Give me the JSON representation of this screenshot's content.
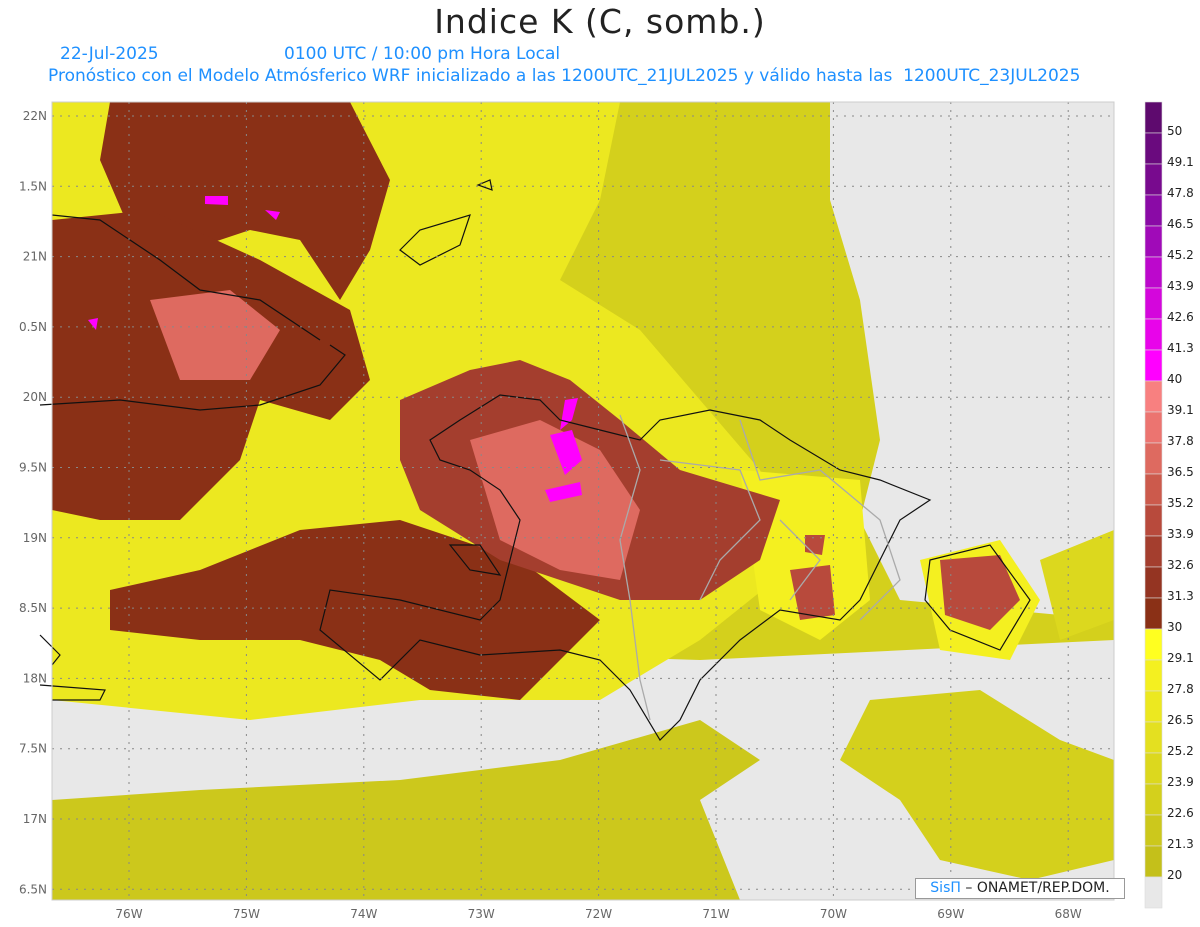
{
  "header": {
    "title": "Indice K (C, somb.)",
    "date": "22-Jul-2025",
    "time": "0100 UTC / 10:00 pm Hora Local",
    "description": "Pronóstico con el Modelo Atmósferico WRF inicializado a las 1200UTC_21JUL2025 y válido hasta las  1200UTC_23JUL2025"
  },
  "axes": {
    "lon_labels": [
      "76W",
      "75W",
      "74W",
      "73W",
      "72W",
      "71W",
      "70W",
      "69W",
      "68W"
    ],
    "lat_labels": [
      "22N",
      "1.5N",
      "21N",
      "0.5N",
      "20N",
      "9.5N",
      "19N",
      "8.5N",
      "18N",
      "7.5N",
      "17N",
      "6.5N"
    ]
  },
  "colorbar": {
    "labels": [
      "50",
      "49.1",
      "47.8",
      "46.5",
      "45.2",
      "43.9",
      "42.6",
      "41.3",
      "40",
      "39.1",
      "37.8",
      "36.5",
      "35.2",
      "33.9",
      "32.6",
      "31.3",
      "30",
      "29.1",
      "27.8",
      "26.5",
      "25.2",
      "23.9",
      "22.6",
      "21.3",
      "20"
    ],
    "colors": [
      "#5e0a6e",
      "#6a0a7e",
      "#780a8e",
      "#8a0aa6",
      "#a00ab8",
      "#bc08cc",
      "#d406dc",
      "#e804ea",
      "#ff00ff",
      "#f88080",
      "#ec7470",
      "#de6a60",
      "#cc5a4c",
      "#b84a3c",
      "#a43e2e",
      "#943422",
      "#8a3016",
      "#ffff20",
      "#f4f020",
      "#ece820",
      "#e4e020",
      "#dcd81e",
      "#d4d01c",
      "#ccc81c",
      "#c4c01a",
      "#e8e8e8"
    ]
  },
  "credit": {
    "brand": "SisΠ",
    "separator": " – ",
    "org": "ONAMET/REP.DOM."
  }
}
